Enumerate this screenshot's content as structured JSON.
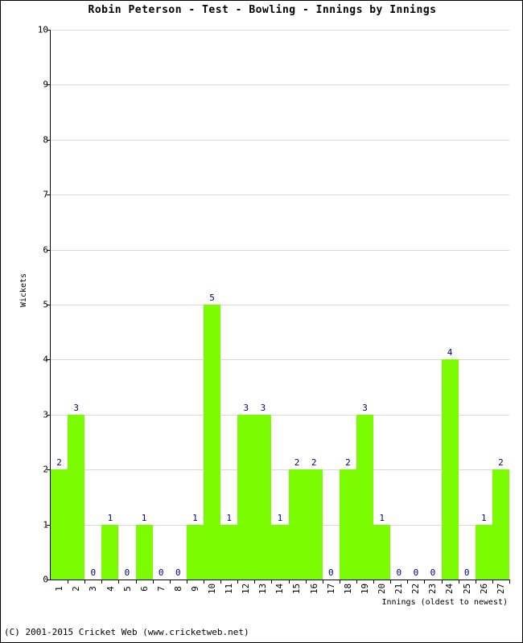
{
  "chart_data": {
    "type": "bar",
    "title": "Robin Peterson - Test - Bowling - Innings by Innings",
    "xlabel": "Innings (oldest to newest)",
    "ylabel": "Wickets",
    "ylim": [
      0,
      10
    ],
    "yticks": [
      0,
      1,
      2,
      3,
      4,
      5,
      6,
      7,
      8,
      9,
      10
    ],
    "grid": true,
    "legend": null,
    "bar_color": "#7CFC00",
    "value_label_color": "#000080",
    "categories": [
      "1",
      "2",
      "3",
      "4",
      "5",
      "6",
      "7",
      "8",
      "9",
      "10",
      "11",
      "12",
      "13",
      "14",
      "15",
      "16",
      "17",
      "18",
      "19",
      "20",
      "21",
      "22",
      "23",
      "24",
      "25",
      "26",
      "27"
    ],
    "values": [
      2,
      3,
      0,
      1,
      0,
      1,
      0,
      0,
      1,
      5,
      1,
      3,
      3,
      1,
      2,
      2,
      0,
      2,
      3,
      1,
      0,
      0,
      0,
      4,
      0,
      1,
      2
    ]
  },
  "footer": {
    "copyright": "(C) 2001-2015 Cricket Web (www.cricketweb.net)"
  }
}
